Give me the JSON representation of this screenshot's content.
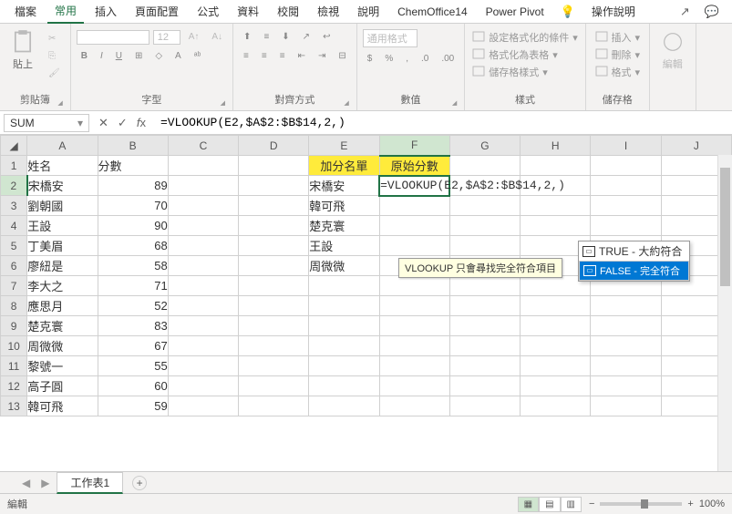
{
  "tabs": [
    "檔案",
    "常用",
    "插入",
    "頁面配置",
    "公式",
    "資料",
    "校閱",
    "檢視",
    "說明",
    "ChemOffice14",
    "Power Pivot"
  ],
  "active_tab_index": 1,
  "tab_tell_me": "操作說明",
  "ribbon": {
    "clipboard": {
      "paste": "貼上",
      "label": "剪貼簿"
    },
    "font": {
      "size": "12",
      "label": "字型"
    },
    "align": {
      "label": "對齊方式"
    },
    "number": {
      "format": "通用格式",
      "label": "數值"
    },
    "styles": {
      "cond": "設定格式化的條件",
      "table": "格式化為表格",
      "cell": "儲存格樣式",
      "label": "樣式"
    },
    "cells": {
      "insert": "插入",
      "delete": "刪除",
      "format": "格式",
      "label": "儲存格"
    },
    "editing": {
      "label": "編輯"
    }
  },
  "name_box": "SUM",
  "formula": "=VLOOKUP(E2,$A$2:$B$14,2,)",
  "headers": [
    "A",
    "B",
    "C",
    "D",
    "E",
    "F",
    "G",
    "H",
    "I",
    "J"
  ],
  "active_col": 5,
  "active_row": 2,
  "chart_data": {
    "type": "table",
    "title": "",
    "columns_ab": {
      "A_header": "姓名",
      "B_header": "分數",
      "rows": [
        {
          "name": "宋橋安",
          "score": 89
        },
        {
          "name": "劉朝國",
          "score": 70
        },
        {
          "name": "王設",
          "score": 90
        },
        {
          "name": "丁美眉",
          "score": 68
        },
        {
          "name": "廖紐是",
          "score": 58
        },
        {
          "name": "李大之",
          "score": 71
        },
        {
          "name": "應思月",
          "score": 52
        },
        {
          "name": "楚克寰",
          "score": 83
        },
        {
          "name": "周微微",
          "score": 67
        },
        {
          "name": "黎號一",
          "score": 55
        },
        {
          "name": "高子圓",
          "score": 60
        },
        {
          "name": "韓可飛",
          "score": 59
        }
      ]
    },
    "columns_ef": {
      "E_header": "加分名單",
      "F_header": "原始分數",
      "names": [
        "宋橋安",
        "韓可飛",
        "楚克寰",
        "王設",
        "周微微"
      ]
    }
  },
  "cell_formula_display": "=VLOOKUP(E2,$A$2:$B$14,2,)",
  "autocomplete": {
    "items": [
      "TRUE - 大約符合",
      "FALSE - 完全符合"
    ],
    "selected": 1
  },
  "tooltip": "VLOOKUP 只會尋找完全符合項目",
  "sheet": {
    "name": "工作表1"
  },
  "status": {
    "mode": "編輯",
    "zoom": "100%"
  }
}
